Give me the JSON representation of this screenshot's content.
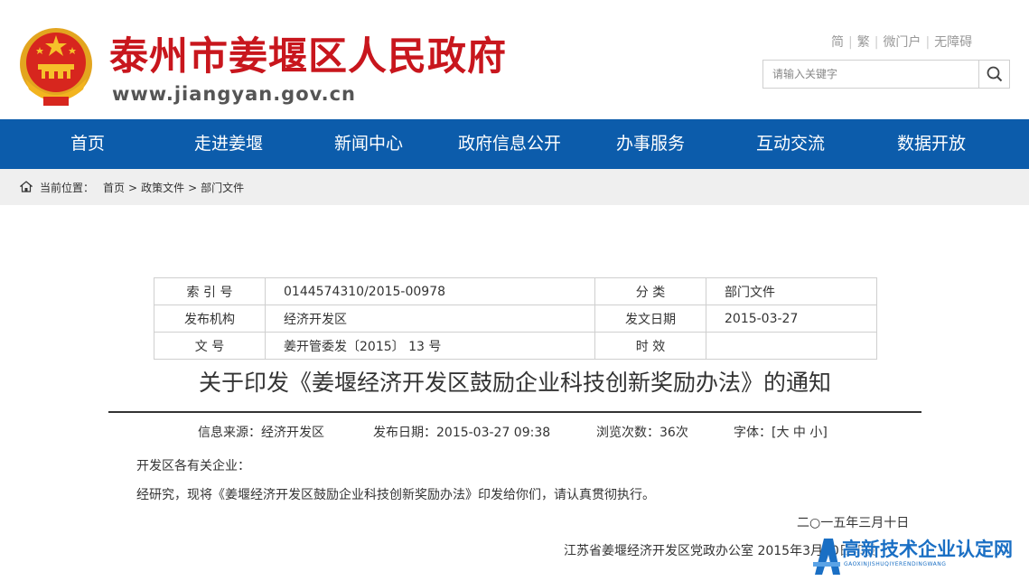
{
  "header": {
    "site_title": "泰州市姜堰区人民政府",
    "site_url": "www.jiangyan.gov.cn",
    "links": [
      "简",
      "繁",
      "微门户",
      "无障碍"
    ],
    "search_placeholder": "请输入关键字",
    "brand_red": "#c8161d",
    "brand_blue": "#0c5cab"
  },
  "nav": {
    "items": [
      "首页",
      "走进姜堰",
      "新闻中心",
      "政府信息公开",
      "办事服务",
      "互动交流",
      "数据开放"
    ]
  },
  "breadcrumb": {
    "label": "当前位置：",
    "items": [
      "首页",
      "政策文件",
      "部门文件"
    ],
    "separator": ">"
  },
  "meta_table": {
    "rows": [
      {
        "k1": "索 引 号",
        "v1": "0144574310/2015-00978",
        "k2": "分 类",
        "v2": "部门文件"
      },
      {
        "k1": "发布机构",
        "v1": "经济开发区",
        "k2": "发文日期",
        "v2": "2015-03-27"
      },
      {
        "k1": "文 号",
        "v1": "姜开管委发〔2015〕 13 号",
        "k2": "时 效",
        "v2": ""
      }
    ]
  },
  "article": {
    "title": "关于印发《姜堰经济开发区鼓励企业科技创新奖励办法》的通知",
    "source": "信息来源：经济开发区",
    "publish_date": "发布日期：2015-03-27 09:38",
    "views": "浏览次数：36次",
    "font_label": "字体：[",
    "font_large": "大",
    "font_medium": "中",
    "font_small": "小",
    "font_close": "]",
    "salutation": "开发区各有关企业：",
    "body": "经研究，现将《姜堰经济开发区鼓励企业科技创新奖励办法》印发给你们，请认真贯彻执行。",
    "sign_date": "二○一五年三月十日",
    "footer_line": "江苏省姜堰经济开发区党政办公室  2015年3月10日印发"
  },
  "watermark": {
    "text": "高新技术企业认定网",
    "sub": "GAOXINJISHUQIYERENDINGWANG",
    "color": "#1a6fc4"
  }
}
